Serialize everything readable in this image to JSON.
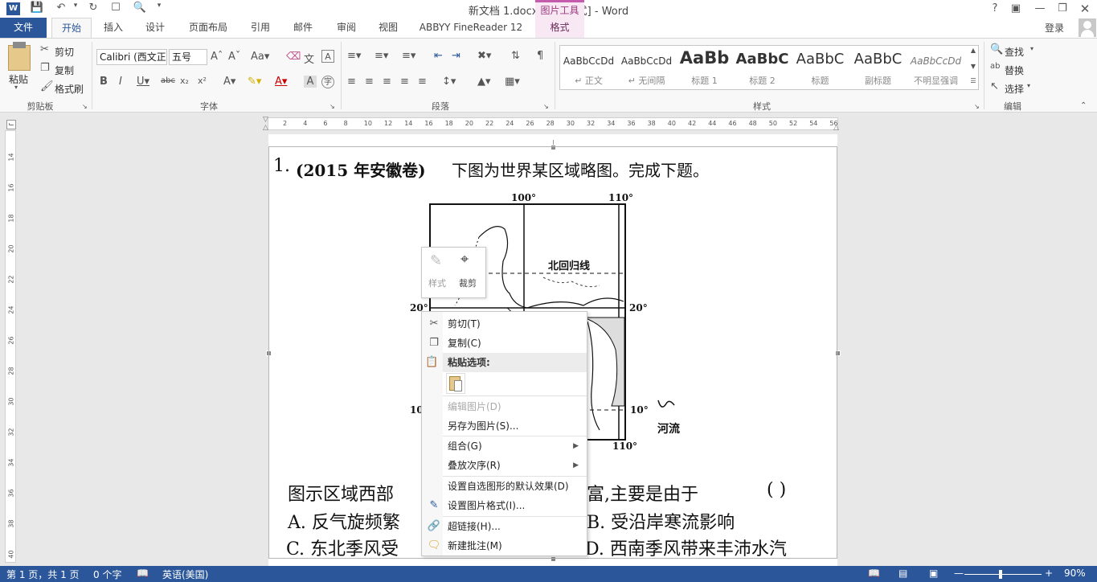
{
  "app": {
    "title": "新文档 1.docx [兼容模式] - Word",
    "context_tool_title": "图片工具",
    "help": "?",
    "user": "登录"
  },
  "tabs": [
    "文件",
    "开始",
    "插入",
    "设计",
    "页面布局",
    "引用",
    "邮件",
    "审阅",
    "视图",
    "ABBYY FineReader 12",
    "格式"
  ],
  "clipboard": {
    "paste": "粘贴",
    "cut": "剪切",
    "copy": "复制",
    "format_painter": "格式刷",
    "group": "剪贴板"
  },
  "font": {
    "name": "Calibri (西文正",
    "size": "五号",
    "group": "字体"
  },
  "paragraph": {
    "group": "段落"
  },
  "styles": {
    "group": "样式",
    "items": [
      {
        "sample": "AaBbCcDd",
        "name": "↵ 正文"
      },
      {
        "sample": "AaBbCcDd",
        "name": "↵ 无间隔"
      },
      {
        "sample": "AaBb",
        "name": "标题 1"
      },
      {
        "sample": "AaBbC",
        "name": "标题 2"
      },
      {
        "sample": "AaBbC",
        "name": "标题"
      },
      {
        "sample": "AaBbC",
        "name": "副标题"
      },
      {
        "sample": "AaBbCcDd",
        "name": "不明显强调"
      }
    ]
  },
  "editing": {
    "find": "查找",
    "replace": "替换",
    "select": "选择",
    "group": "编辑"
  },
  "ruler_h": [
    "2",
    "4",
    "6",
    "8",
    "10",
    "12",
    "14",
    "16",
    "18",
    "20",
    "22",
    "24",
    "26",
    "28",
    "30",
    "32",
    "34",
    "36",
    "38",
    "40",
    "42",
    "44",
    "46",
    "48",
    "50",
    "52",
    "54",
    "56"
  ],
  "ruler_v": [
    "14",
    "16",
    "18",
    "20",
    "22",
    "24",
    "26",
    "28",
    "30",
    "32",
    "34",
    "36",
    "38",
    "40"
  ],
  "document": {
    "q_num": "1.",
    "q_source": "(2015 年安徽卷)",
    "q_text": "下图为世界某区域略图。完成下题。",
    "map": {
      "lon100": "100°",
      "lon110_top": "110°",
      "tropic": "北回归线",
      "lat20_left": "20°",
      "lat20_right": "20°",
      "lat10_left": "10",
      "lat10_right": "10°",
      "lon110_bottom": "110°",
      "legend_river": "河流"
    },
    "sub_q_left": "图示区域西部",
    "sub_q_right": "富,主要是由于",
    "sub_q_paren": "(        )",
    "opt_a": "A. 反气旋频繁",
    "opt_b": "B. 受沿岸寒流影响",
    "opt_c": "C. 东北季风受",
    "opt_d": "D. 西南季风带来丰沛水汽"
  },
  "mini_toolbar": {
    "style": "样式",
    "crop": "裁剪"
  },
  "context_menu": {
    "cut": "剪切(T)",
    "copy": "复制(C)",
    "paste_options": "粘贴选项:",
    "edit_picture": "编辑图片(D)",
    "save_as_picture": "另存为图片(S)...",
    "group": "组合(G)",
    "order": "叠放次序(R)",
    "set_default_shape": "设置自选图形的默认效果(D)",
    "format_picture": "设置图片格式(I)...",
    "hyperlink": "超链接(H)...",
    "new_comment": "新建批注(M)"
  },
  "status": {
    "page": "第 1 页，共 1 页",
    "words": "0 个字",
    "language": "英语(美国)",
    "zoom": "90%",
    "zoom_level": 0.9
  }
}
